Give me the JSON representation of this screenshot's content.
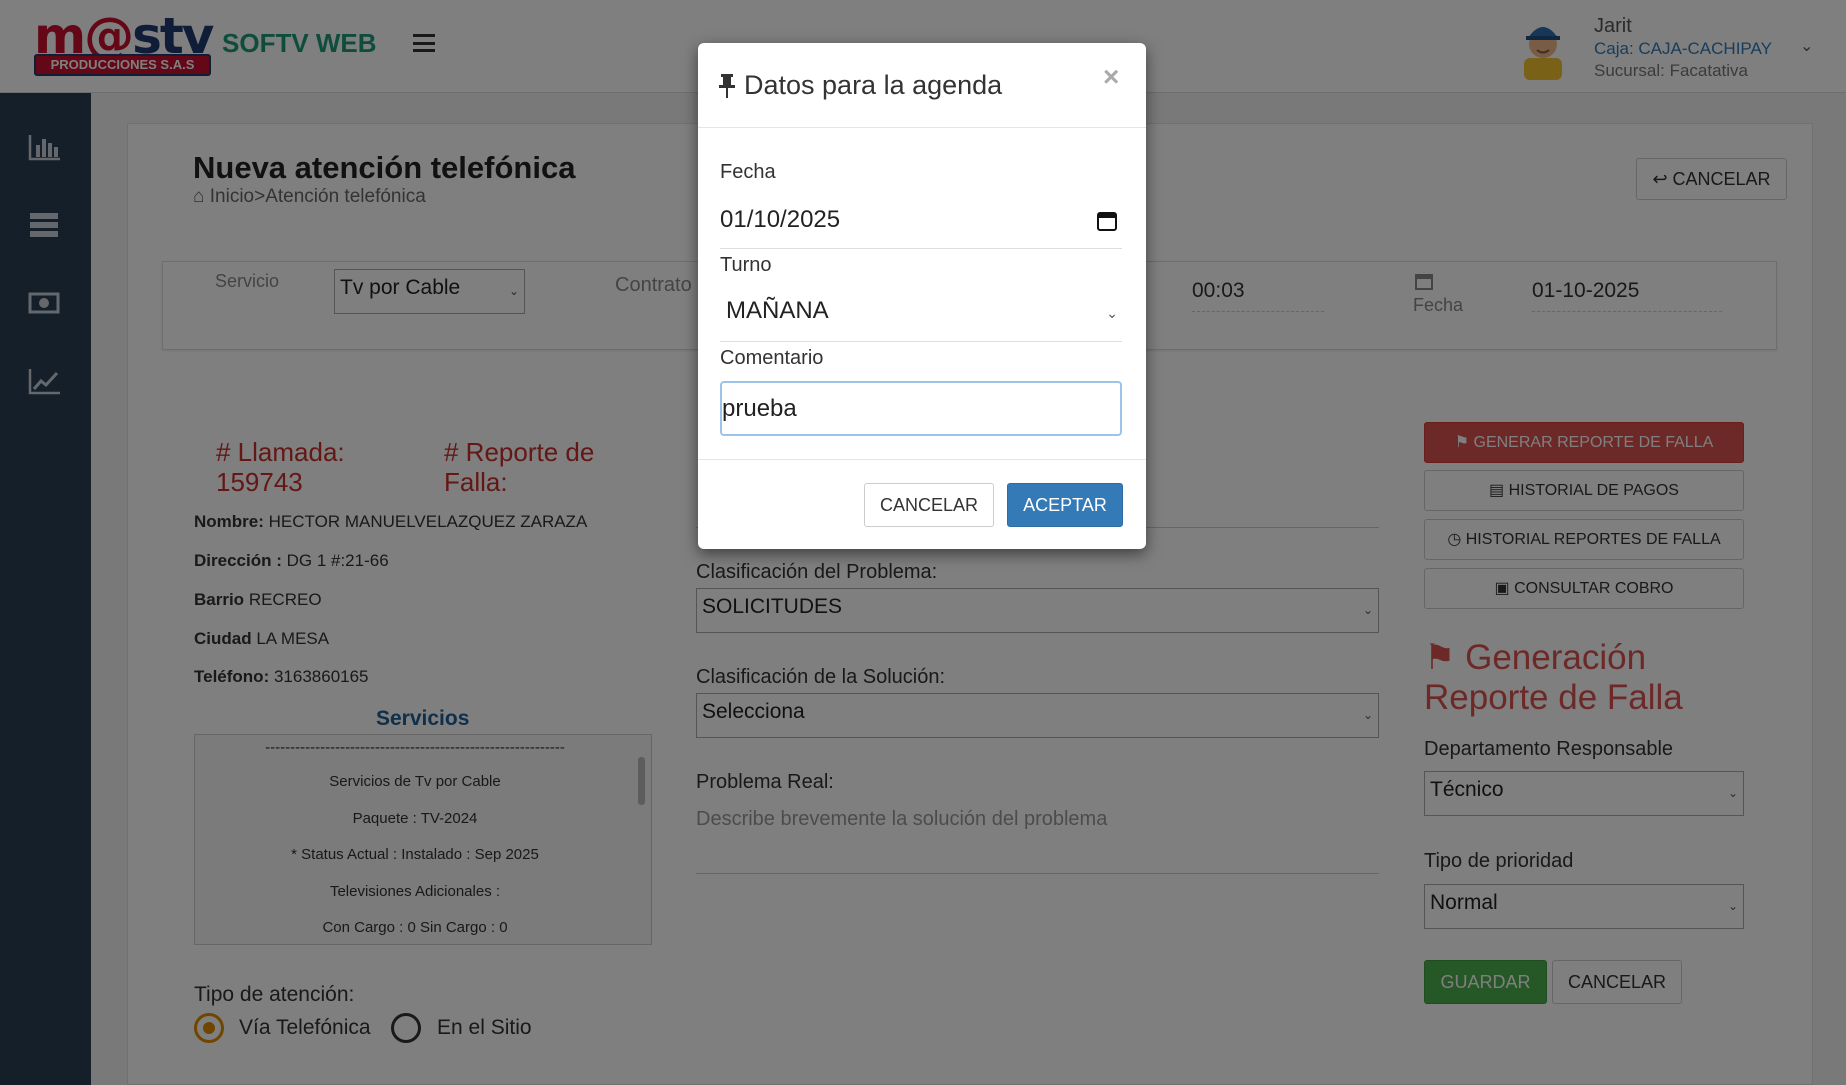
{
  "header": {
    "logo_main": "m@stv",
    "logo_sub": "PRODUCCIONES S.A.S",
    "brand": "SOFTV WEB",
    "user": {
      "name": "Jarit",
      "caja": "Caja: CAJA-CACHIPAY",
      "sucursal": "Sucursal: Facatativa"
    }
  },
  "page": {
    "title": "Nueva atención telefónica",
    "breadcrumb": "Inicio>Atención telefónica",
    "cancel_label": "CANCELAR"
  },
  "filters": {
    "servicio_label": "Servicio",
    "servicio_value": "Tv por Cable",
    "contrato_label": "Contrato",
    "hora_value": "00:03",
    "fecha_label": "Fecha",
    "fecha_value": "01-10-2025"
  },
  "client": {
    "llamada_label": "# Llamada:",
    "llamada_value": "159743",
    "reporte_label": "# Reporte de",
    "reporte_label2": "Falla:",
    "nombre_label": "Nombre:",
    "nombre_value": "HECTOR MANUELVELAZQUEZ ZARAZA",
    "direccion_label": "Dirección :",
    "direccion_value": "DG 1 #:21-66",
    "barrio_label": "Barrio",
    "barrio_value": "RECREO",
    "ciudad_label": "Ciudad",
    "ciudad_value": "LA MESA",
    "telefono_label": "Teléfono:",
    "telefono_value": "3163860165"
  },
  "servicios": {
    "title": "Servicios",
    "lines": [
      "------------------------------------------------------------",
      "Servicios de Tv por Cable",
      "Paquete : TV-2024",
      "* Status Actual : Instalado : Sep 2025",
      "Televisiones Adicionales :",
      "Con Cargo : 0 Sin Cargo : 0"
    ]
  },
  "atencion": {
    "label": "Tipo de atención:",
    "option1": "Vía Telefónica",
    "option2": "En el Sitio",
    "selected": "Vía Telefónica"
  },
  "middle": {
    "clasif_problema_label": "Clasificación del Problema:",
    "clasif_problema_value": "SOLICITUDES",
    "clasif_solucion_label": "Clasificación de la Solución:",
    "clasif_solucion_value": "Selecciona",
    "problema_real_label": "Problema Real:",
    "problema_real_placeholder": "Describe brevemente la solución del problema"
  },
  "right": {
    "btn_generar": "GENERAR REPORTE DE FALLA",
    "btn_historial_pagos": "HISTORIAL DE PAGOS",
    "btn_historial_reportes": "HISTORIAL REPORTES DE FALLA",
    "btn_consultar": "CONSULTAR COBRO",
    "gen_title_1": "Generación",
    "gen_title_2": "Reporte de Falla",
    "depto_label": "Departamento Responsable",
    "depto_value": "Técnico",
    "prioridad_label": "Tipo de prioridad",
    "prioridad_value": "Normal",
    "guardar": "GUARDAR",
    "cancelar": "CANCELAR"
  },
  "modal": {
    "title": "Datos para la agenda",
    "close": "×",
    "fecha_label": "Fecha",
    "fecha_value": "01/10/2025",
    "turno_label": "Turno",
    "turno_value": "MAÑANA",
    "comentario_label": "Comentario",
    "comentario_value": "prueba",
    "cancel": "CANCELAR",
    "ok": "ACEPTAR"
  },
  "colors": {
    "brand_green": "#1c9a77",
    "danger": "#d9534f",
    "primary": "#337ab7",
    "success": "#4cae4c",
    "sidebar": "#2a3f54"
  }
}
